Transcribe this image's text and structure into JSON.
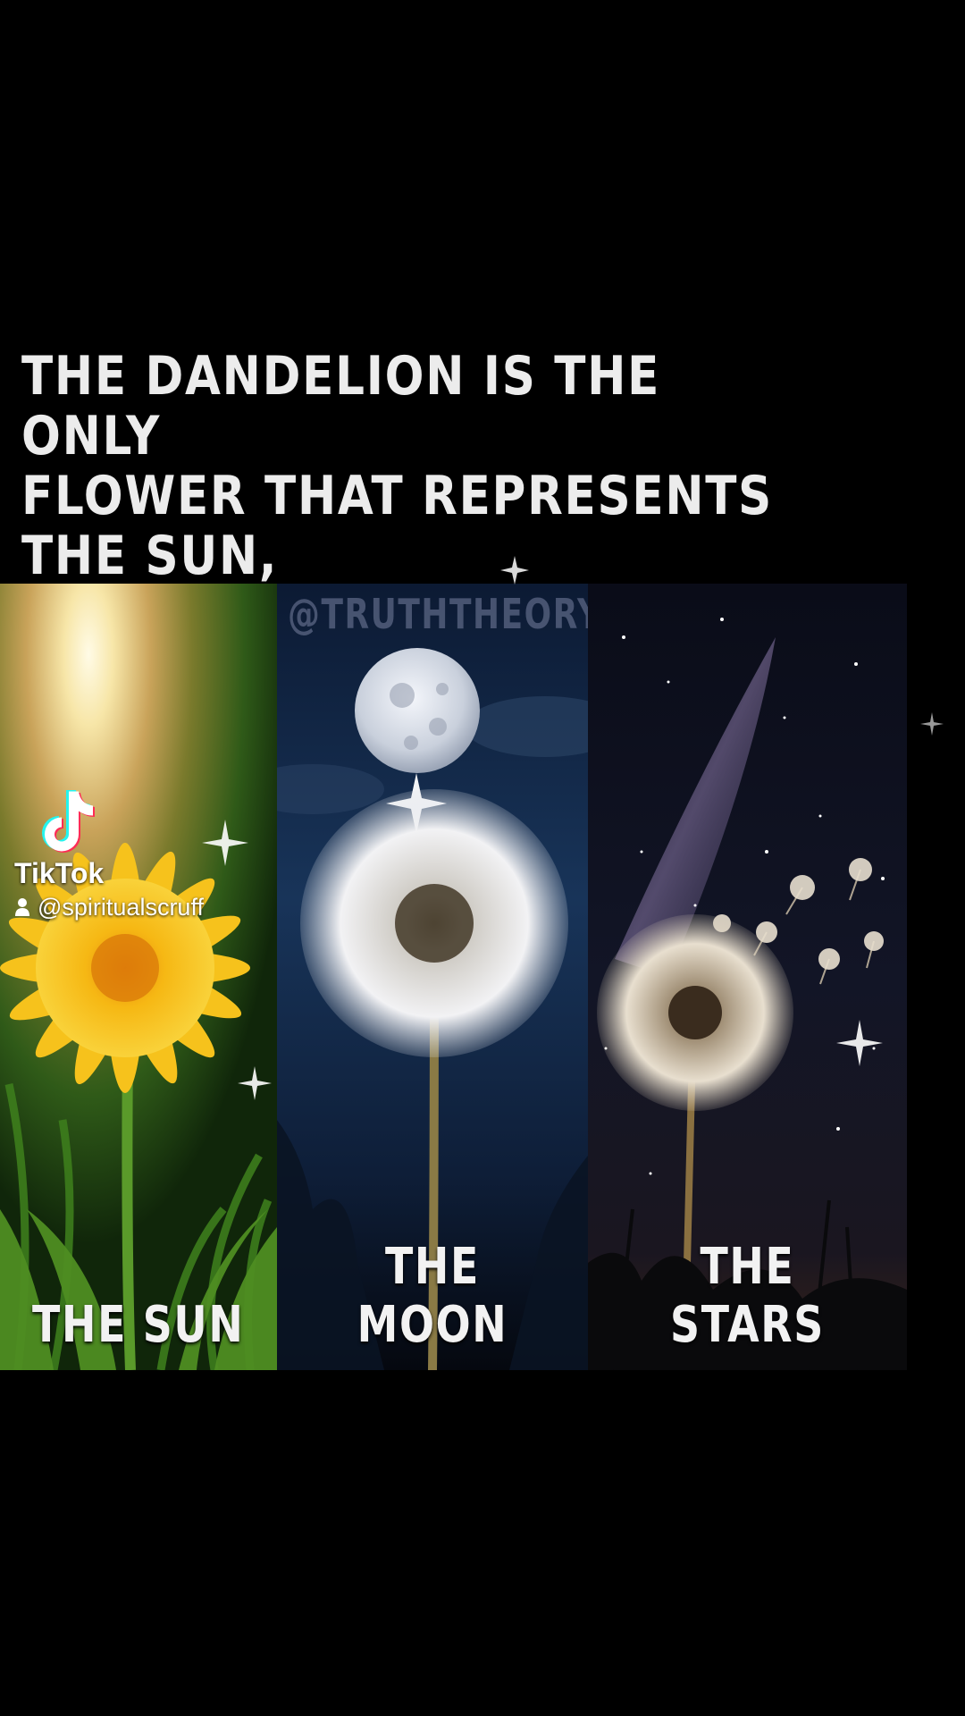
{
  "headline": "THE DANDELION IS THE ONLY\nFLOWER THAT REPRESENTS THE SUN,\nMOON AND STARS.",
  "watermark": "@TRUTHTHEORY",
  "panels": [
    {
      "caption": "THE SUN"
    },
    {
      "caption": "THE MOON"
    },
    {
      "caption": "THE STARS"
    }
  ],
  "tiktok": {
    "brand": "TikTok",
    "username": "@spiritualscruff"
  },
  "colors": {
    "background": "#000000",
    "sun_glow": "#fff4c8",
    "grass": "#3f7a1e",
    "dandelion_yellow": "#f2b416",
    "night_sky": "#0e1f3c",
    "star_sky": "#0b0d18"
  }
}
